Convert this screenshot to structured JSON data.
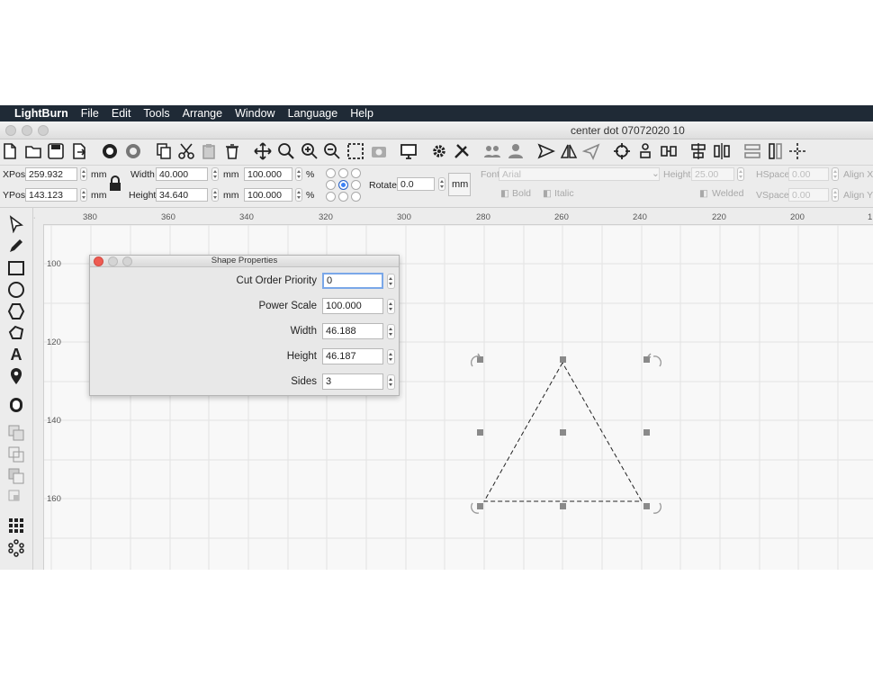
{
  "menubar": {
    "app": "LightBurn",
    "items": [
      "File",
      "Edit",
      "Tools",
      "Arrange",
      "Window",
      "Language",
      "Help"
    ]
  },
  "window": {
    "title": "center dot 07072020 10"
  },
  "toolbar_icons": [
    "new-file-icon",
    "open-folder-icon",
    "save-icon",
    "import-icon",
    "circle-dark-icon",
    "circle-grey-icon",
    "copy-icon",
    "cut-icon",
    "paste-icon",
    "delete-icon",
    "move-icon",
    "zoom-fit-icon",
    "zoom-in-icon",
    "zoom-out-icon",
    "zoom-select-icon",
    "camera-icon",
    "monitor-icon",
    "settings-icon",
    "tools-icon",
    "users-icon",
    "user-icon",
    "send-icon",
    "mirror-icon",
    "plane-icon",
    "target-icon",
    "align-center-v-icon",
    "align-center-h-icon",
    "distribute-icon",
    "spacing-h-icon",
    "spacing-v-icon",
    "move-laser-icon"
  ],
  "position": {
    "xpos_label": "XPos",
    "xpos": "259.932",
    "ypos_label": "YPos",
    "ypos": "143.123",
    "unit": "mm",
    "width_label": "Width",
    "width": "40.000",
    "height_label": "Height",
    "height": "34.640",
    "scale_w": "100.000",
    "scale_h": "100.000",
    "pct": "%",
    "rotate_label": "Rotate",
    "rotate": "0.0",
    "mm_button": "mm"
  },
  "text_props": {
    "font_label": "Font",
    "font": "Arial",
    "height_label": "Height",
    "height": "25.00",
    "hspace_label": "HSpace",
    "hspace": "0.00",
    "vspace_label": "VSpace",
    "vspace": "0.00",
    "align_x": "Align X",
    "align_y": "Align Y",
    "bold": "Bold",
    "italic": "Italic",
    "welded": "Welded"
  },
  "ruler": {
    "x_ticks": [
      "380",
      "360",
      "340",
      "320",
      "300",
      "280",
      "260",
      "240",
      "220",
      "200",
      "1"
    ],
    "y_ticks": [
      "100",
      "120",
      "140",
      "160"
    ]
  },
  "dialog": {
    "title": "Shape Properties",
    "rows": [
      {
        "label": "Cut Order Priority",
        "value": "0"
      },
      {
        "label": "Power Scale",
        "value": "100.000"
      },
      {
        "label": "Width",
        "value": "46.188"
      },
      {
        "label": "Height",
        "value": "46.187"
      },
      {
        "label": "Sides",
        "value": "3"
      }
    ]
  },
  "left_tool_icons": [
    "select-icon",
    "pen-icon",
    "rectangle-icon",
    "ellipse-icon",
    "polygon-icon",
    "bezier-icon",
    "text-icon",
    "position-laser-icon",
    "offset-icon",
    "weld-icon",
    "union-icon",
    "subtract-icon",
    "intersect-icon",
    "grid-array-icon",
    "circular-array-icon"
  ],
  "colors": {
    "menubar": "#1f2a36",
    "accent": "#3b82f6",
    "close": "#ee5b52"
  }
}
